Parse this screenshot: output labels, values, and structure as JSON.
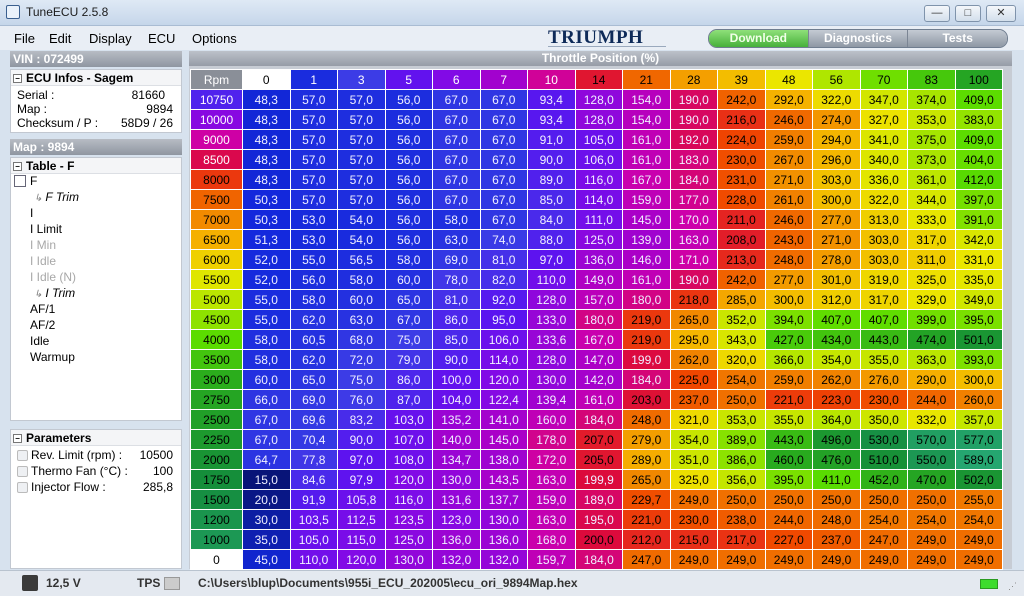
{
  "window": {
    "title": "TuneECU 2.5.8",
    "controls": {
      "minimize": "—",
      "maximize": "□",
      "close": "✕"
    }
  },
  "menu": [
    "File",
    "Edit",
    "Display",
    "ECU",
    "Options"
  ],
  "logo": "TRIUMPH",
  "tabs": [
    {
      "label": "Download",
      "active": true
    },
    {
      "label": "Diagnostics",
      "active": false
    },
    {
      "label": "Tests",
      "active": false
    }
  ],
  "sidebar": {
    "vin_header": "VIN : 072499",
    "ecu_infos": {
      "title": "ECU Infos -  Sagem",
      "rows": [
        {
          "label": "Serial :",
          "value": "81660"
        },
        {
          "label": "Map :",
          "value": "9894"
        },
        {
          "label": "Checksum / P :",
          "value": "58D9 / 26"
        }
      ]
    },
    "map_header": "Map : 9894",
    "table_section": {
      "title": "Table - F",
      "items": [
        {
          "label": "F",
          "style": "normal"
        },
        {
          "label": "F Trim",
          "style": "sub"
        },
        {
          "label": "I",
          "style": "normal"
        },
        {
          "label": "I Limit",
          "style": "normal"
        },
        {
          "label": "I Min",
          "style": "dim"
        },
        {
          "label": "I Idle",
          "style": "dim"
        },
        {
          "label": "I Idle (N)",
          "style": "dim"
        },
        {
          "label": "I Trim",
          "style": "sub"
        },
        {
          "label": "AF/1",
          "style": "normal"
        },
        {
          "label": "AF/2",
          "style": "normal"
        },
        {
          "label": "Idle",
          "style": "normal"
        },
        {
          "label": "Warmup",
          "style": "normal"
        }
      ]
    },
    "parameters": {
      "title": "Parameters",
      "rows": [
        {
          "label": "Rev. Limit (rpm) :",
          "value": "10500"
        },
        {
          "label": "Thermo Fan (°C) :",
          "value": "100"
        },
        {
          "label": "Injector Flow :",
          "value": "285,8"
        }
      ]
    }
  },
  "map": {
    "header": "Throttle Position (%)",
    "corner": "Rpm",
    "columns": [
      "0",
      "1",
      "3",
      "5",
      "6",
      "7",
      "10",
      "14",
      "21",
      "28",
      "39",
      "48",
      "56",
      "70",
      "83",
      "100"
    ],
    "rows": [
      {
        "rpm": "10750",
        "values": [
          "48,3",
          "57,0",
          "57,0",
          "56,0",
          "67,0",
          "67,0",
          "93,4",
          "128,0",
          "154,0",
          "190,0",
          "242,0",
          "292,0",
          "322,0",
          "347,0",
          "374,0",
          "409,0"
        ]
      },
      {
        "rpm": "10000",
        "values": [
          "48,3",
          "57,0",
          "57,0",
          "56,0",
          "67,0",
          "67,0",
          "93,4",
          "128,0",
          "154,0",
          "190,0",
          "216,0",
          "246,0",
          "274,0",
          "327,0",
          "353,0",
          "383,0"
        ]
      },
      {
        "rpm": "9000",
        "values": [
          "48,3",
          "57,0",
          "57,0",
          "56,0",
          "67,0",
          "67,0",
          "91,0",
          "105,0",
          "161,0",
          "192,0",
          "224,0",
          "259,0",
          "294,0",
          "341,0",
          "375,0",
          "409,0"
        ]
      },
      {
        "rpm": "8500",
        "values": [
          "48,3",
          "57,0",
          "57,0",
          "56,0",
          "67,0",
          "67,0",
          "90,0",
          "106,0",
          "161,0",
          "183,0",
          "230,0",
          "267,0",
          "296,0",
          "340,0",
          "373,0",
          "404,0"
        ]
      },
      {
        "rpm": "8000",
        "values": [
          "48,3",
          "57,0",
          "57,0",
          "56,0",
          "67,0",
          "67,0",
          "89,0",
          "116,0",
          "167,0",
          "184,0",
          "231,0",
          "271,0",
          "303,0",
          "336,0",
          "361,0",
          "412,0"
        ]
      },
      {
        "rpm": "7500",
        "values": [
          "50,3",
          "57,0",
          "57,0",
          "56,0",
          "67,0",
          "67,0",
          "85,0",
          "114,0",
          "159,0",
          "177,0",
          "228,0",
          "261,0",
          "300,0",
          "322,0",
          "344,0",
          "397,0"
        ]
      },
      {
        "rpm": "7000",
        "values": [
          "50,3",
          "53,0",
          "54,0",
          "56,0",
          "58,0",
          "67,0",
          "84,0",
          "111,0",
          "145,0",
          "170,0",
          "211,0",
          "246,0",
          "277,0",
          "313,0",
          "333,0",
          "391,0"
        ]
      },
      {
        "rpm": "6500",
        "values": [
          "51,3",
          "53,0",
          "54,0",
          "56,0",
          "63,0",
          "74,0",
          "88,0",
          "125,0",
          "139,0",
          "163,0",
          "208,0",
          "243,0",
          "271,0",
          "303,0",
          "317,0",
          "342,0"
        ]
      },
      {
        "rpm": "6000",
        "values": [
          "52,0",
          "55,0",
          "56,5",
          "58,0",
          "69,0",
          "81,0",
          "97,0",
          "136,0",
          "146,0",
          "171,0",
          "213,0",
          "248,0",
          "278,0",
          "303,0",
          "311,0",
          "331,0"
        ]
      },
      {
        "rpm": "5500",
        "values": [
          "52,0",
          "56,0",
          "58,0",
          "60,0",
          "78,0",
          "82,0",
          "110,0",
          "149,0",
          "161,0",
          "190,0",
          "242,0",
          "277,0",
          "301,0",
          "319,0",
          "325,0",
          "335,0"
        ]
      },
      {
        "rpm": "5000",
        "values": [
          "55,0",
          "58,0",
          "60,0",
          "65,0",
          "81,0",
          "92,0",
          "128,0",
          "157,0",
          "180,0",
          "218,0",
          "285,0",
          "300,0",
          "312,0",
          "317,0",
          "329,0",
          "349,0"
        ]
      },
      {
        "rpm": "4500",
        "values": [
          "55,0",
          "62,0",
          "63,0",
          "67,0",
          "86,0",
          "95,0",
          "133,0",
          "180,0",
          "219,0",
          "265,0",
          "352,0",
          "394,0",
          "407,0",
          "407,0",
          "399,0",
          "395,0"
        ]
      },
      {
        "rpm": "4000",
        "values": [
          "58,0",
          "60,5",
          "68,0",
          "75,0",
          "85,0",
          "106,0",
          "133,6",
          "167,0",
          "219,0",
          "295,0",
          "343,0",
          "427,0",
          "434,0",
          "443,0",
          "474,0",
          "501,0"
        ]
      },
      {
        "rpm": "3500",
        "values": [
          "58,0",
          "62,0",
          "72,0",
          "79,0",
          "90,0",
          "114,0",
          "128,0",
          "147,0",
          "199,0",
          "262,0",
          "320,0",
          "366,0",
          "354,0",
          "355,0",
          "363,0",
          "393,0"
        ]
      },
      {
        "rpm": "3000",
        "values": [
          "60,0",
          "65,0",
          "75,0",
          "86,0",
          "100,0",
          "120,0",
          "130,0",
          "142,0",
          "184,0",
          "225,0",
          "254,0",
          "259,0",
          "262,0",
          "276,0",
          "290,0",
          "300,0"
        ]
      },
      {
        "rpm": "2750",
        "values": [
          "66,0",
          "69,0",
          "76,0",
          "87,0",
          "104,0",
          "122,4",
          "139,4",
          "161,0",
          "203,0",
          "237,0",
          "250,0",
          "221,0",
          "223,0",
          "230,0",
          "244,0",
          "260,0"
        ]
      },
      {
        "rpm": "2500",
        "values": [
          "67,0",
          "69,6",
          "83,2",
          "103,0",
          "135,2",
          "141,0",
          "160,0",
          "184,0",
          "248,0",
          "321,0",
          "353,0",
          "355,0",
          "364,0",
          "350,0",
          "332,0",
          "357,0"
        ]
      },
      {
        "rpm": "2250",
        "values": [
          "67,0",
          "70,4",
          "90,0",
          "107,0",
          "140,0",
          "145,0",
          "178,0",
          "207,0",
          "279,0",
          "354,0",
          "389,0",
          "443,0",
          "496,0",
          "530,0",
          "570,0",
          "577,0"
        ]
      },
      {
        "rpm": "2000",
        "values": [
          "64,7",
          "77,8",
          "97,0",
          "108,0",
          "134,7",
          "138,0",
          "172,0",
          "205,0",
          "289,0",
          "351,0",
          "386,0",
          "460,0",
          "476,0",
          "510,0",
          "550,0",
          "589,0"
        ]
      },
      {
        "rpm": "1750",
        "values": [
          "15,0",
          "84,6",
          "97,9",
          "120,0",
          "130,0",
          "143,5",
          "163,0",
          "199,9",
          "265,0",
          "325,0",
          "356,0",
          "395,0",
          "411,0",
          "452,0",
          "470,0",
          "502,0"
        ]
      },
      {
        "rpm": "1500",
        "values": [
          "20,0",
          "91,9",
          "105,8",
          "116,0",
          "131,6",
          "137,7",
          "159,0",
          "189,0",
          "229,7",
          "249,0",
          "250,0",
          "250,0",
          "250,0",
          "250,0",
          "250,0",
          "255,0"
        ]
      },
      {
        "rpm": "1200",
        "values": [
          "30,0",
          "103,5",
          "112,5",
          "123,5",
          "123,0",
          "130,0",
          "163,0",
          "195,0",
          "221,0",
          "230,0",
          "238,0",
          "244,0",
          "248,0",
          "254,0",
          "254,0",
          "254,0"
        ]
      },
      {
        "rpm": "1000",
        "values": [
          "35,0",
          "105,0",
          "115,0",
          "125,0",
          "136,0",
          "136,0",
          "168,0",
          "200,0",
          "212,0",
          "215,0",
          "217,0",
          "227,0",
          "237,0",
          "247,0",
          "249,0",
          "249,0"
        ]
      },
      {
        "rpm": "0",
        "values": [
          "45,0",
          "110,0",
          "120,0",
          "130,0",
          "132,0",
          "132,0",
          "159,7",
          "184,0",
          "247,0",
          "249,0",
          "249,0",
          "249,0",
          "249,0",
          "249,0",
          "249,0",
          "249,0"
        ]
      }
    ]
  },
  "status": {
    "voltage": "12,5 V",
    "tps_label": "TPS",
    "file_path": "C:\\Users\\blup\\Documents\\955i_ECU_202005\\ecu_ori_9894Map.hex"
  }
}
